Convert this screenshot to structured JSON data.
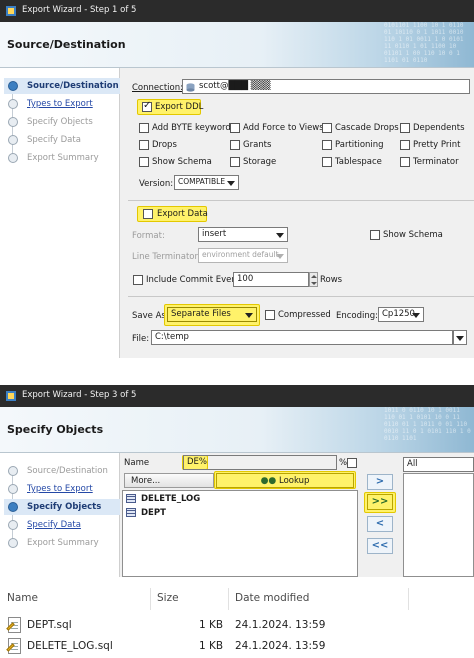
{
  "wizard1": {
    "title": "Export Wizard - Step 1 of 5",
    "banner_title": "Source/Destination",
    "steps": [
      {
        "label": "Source/Destination",
        "state": "active"
      },
      {
        "label": "Types to Export",
        "state": "link"
      },
      {
        "label": "Specify Objects",
        "state": "disabled"
      },
      {
        "label": "Specify Data",
        "state": "disabled"
      },
      {
        "label": "Export Summary",
        "state": "disabled"
      }
    ],
    "connection_label": "Connection:",
    "connection_value": "scott@███ ▒▒▒",
    "export_ddl_label": "Export DDL",
    "ddl_options": [
      {
        "label": "Add BYTE keyword",
        "checked": false
      },
      {
        "label": "Add Force to Views",
        "checked": false
      },
      {
        "label": "Cascade Drops",
        "checked": false
      },
      {
        "label": "Dependents",
        "checked": false
      },
      {
        "label": "Drops",
        "checked": false
      },
      {
        "label": "Grants",
        "checked": false
      },
      {
        "label": "Partitioning",
        "checked": false
      },
      {
        "label": "Pretty Print",
        "checked": false
      },
      {
        "label": "Show Schema",
        "checked": false
      },
      {
        "label": "Storage",
        "checked": false
      },
      {
        "label": "Tablespace",
        "checked": false
      },
      {
        "label": "Terminator",
        "checked": false
      }
    ],
    "version_label": "Version:",
    "version_value": "COMPATIBLE",
    "export_data_label": "Export Data",
    "format_label": "Format:",
    "format_value": "insert",
    "show_schema_label": "Show Schema",
    "line_terminator_label": "Line Terminator:",
    "line_terminator_value": "environment default",
    "include_commit_label": "Include Commit Every",
    "commit_value": "100",
    "rows_label": "Rows",
    "save_as_label": "Save As",
    "save_as_value": "Separate Files",
    "compressed_label": "Compressed",
    "encoding_label": "Encoding:",
    "encoding_value": "Cp1250",
    "file_label": "File:",
    "file_value": "C:\\temp"
  },
  "wizard3": {
    "title": "Export Wizard - Step 3 of 5",
    "banner_title": "Specify Objects",
    "steps": [
      {
        "label": "Source/Destination",
        "state": "disabled"
      },
      {
        "label": "Types to Export",
        "state": "link"
      },
      {
        "label": "Specify Objects",
        "state": "active"
      },
      {
        "label": "Specify Data",
        "state": "link"
      },
      {
        "label": "Export Summary",
        "state": "disabled"
      }
    ],
    "name_label": "Name",
    "name_value": "DE%",
    "percent_label": "%",
    "more_label": "More...",
    "lookup_label": "Lookup",
    "objects": [
      "DELETE_LOG",
      "DEPT"
    ],
    "right_filter_value": "All",
    "arrow_buttons": [
      ">",
      ">>",
      "<",
      "<<"
    ]
  },
  "explorer": {
    "columns": {
      "name": "Name",
      "size": "Size",
      "date": "Date modified"
    },
    "files": [
      {
        "name": "DEPT.sql",
        "size": "1 KB",
        "date": "24.1.2024. 13:59"
      },
      {
        "name": "DELETE_LOG.sql",
        "size": "1 KB",
        "date": "24.1.2024. 13:59"
      }
    ]
  },
  "colors": {
    "highlight": "#fff26a",
    "titlebar": "#2b2b2b",
    "link": "#2448a6",
    "active_step": "#dbe8f6"
  }
}
